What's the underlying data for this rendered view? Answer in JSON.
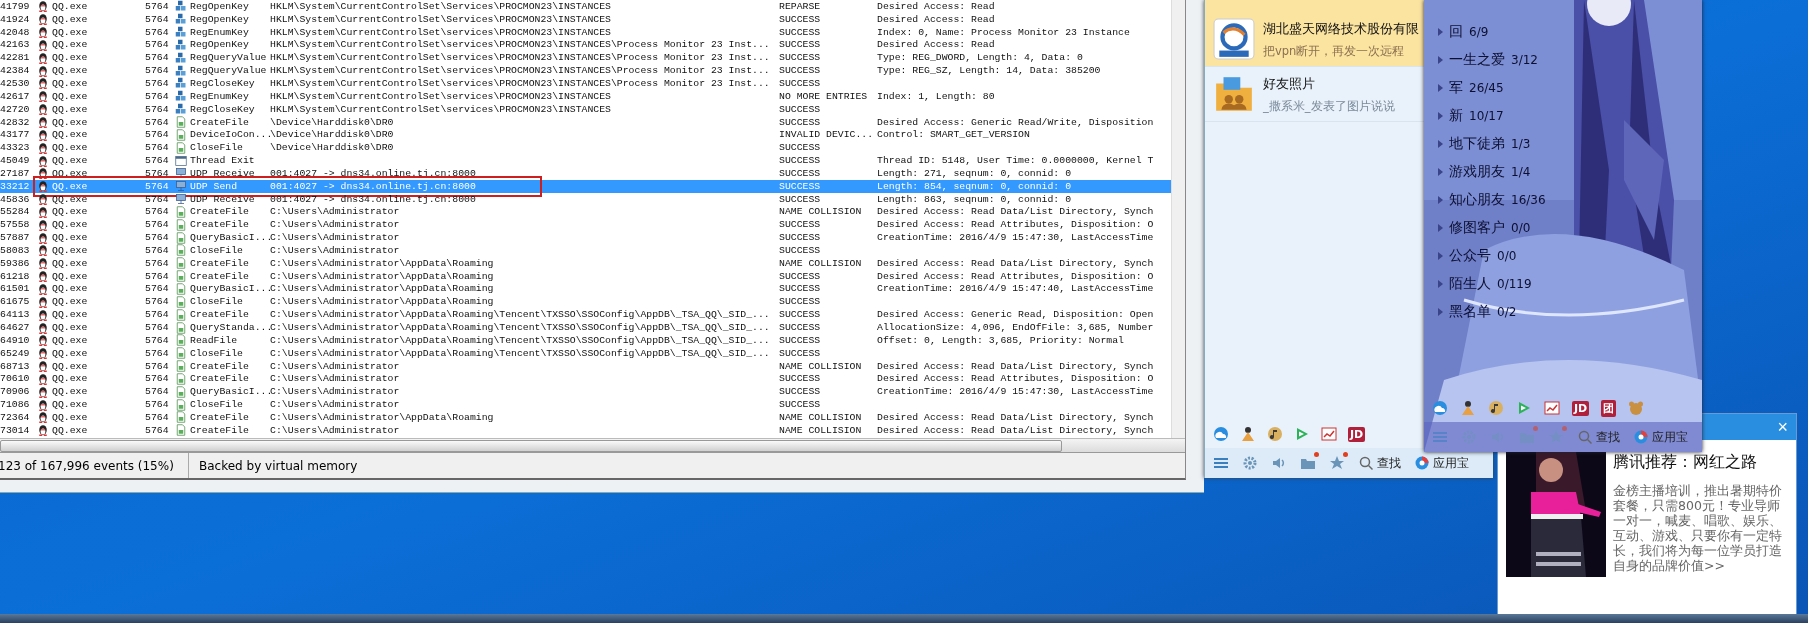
{
  "procmon": {
    "rows": [
      {
        "id": "41799",
        "process": "QQ.exe",
        "pid": "5764",
        "kind": "registry",
        "operation": "RegOpenKey",
        "path": "HKLM\\System\\CurrentControlSet\\Services\\PROCMON23\\INSTANCES",
        "result": "REPARSE",
        "detail": "Desired Access: Read",
        "selected": false,
        "annotated": false
      },
      {
        "id": "41924",
        "process": "QQ.exe",
        "pid": "5764",
        "kind": "registry",
        "operation": "RegOpenKey",
        "path": "HKLM\\System\\CurrentControlSet\\Services\\PROCMON23\\INSTANCES",
        "result": "SUCCESS",
        "detail": "Desired Access: Read",
        "selected": false,
        "annotated": false
      },
      {
        "id": "42048",
        "process": "QQ.exe",
        "pid": "5764",
        "kind": "registry",
        "operation": "RegEnumKey",
        "path": "HKLM\\System\\CurrentControlSet\\services\\PROCMON23\\INSTANCES",
        "result": "SUCCESS",
        "detail": "Index: 0, Name: Process Monitor 23 Instance",
        "selected": false,
        "annotated": false
      },
      {
        "id": "42163",
        "process": "QQ.exe",
        "pid": "5764",
        "kind": "registry",
        "operation": "RegOpenKey",
        "path": "HKLM\\System\\CurrentControlSet\\services\\PROCMON23\\INSTANCES\\Process Monitor 23 Inst...",
        "result": "SUCCESS",
        "detail": "Desired Access: Read",
        "selected": false,
        "annotated": false
      },
      {
        "id": "42281",
        "process": "QQ.exe",
        "pid": "5764",
        "kind": "registry",
        "operation": "RegQueryValue",
        "path": "HKLM\\System\\CurrentControlSet\\services\\PROCMON23\\INSTANCES\\Process Monitor 23 Inst...",
        "result": "SUCCESS",
        "detail": "Type: REG_DWORD, Length: 4, Data: 0",
        "selected": false,
        "annotated": false
      },
      {
        "id": "42384",
        "process": "QQ.exe",
        "pid": "5764",
        "kind": "registry",
        "operation": "RegQueryValue",
        "path": "HKLM\\System\\CurrentControlSet\\services\\PROCMON23\\INSTANCES\\Process Monitor 23 Inst...",
        "result": "SUCCESS",
        "detail": "Type: REG_SZ, Length: 14, Data: 385200",
        "selected": false,
        "annotated": false
      },
      {
        "id": "42530",
        "process": "QQ.exe",
        "pid": "5764",
        "kind": "registry",
        "operation": "RegCloseKey",
        "path": "HKLM\\System\\CurrentControlSet\\services\\PROCMON23\\INSTANCES\\Process Monitor 23 Inst...",
        "result": "SUCCESS",
        "detail": "",
        "selected": false,
        "annotated": false
      },
      {
        "id": "42617",
        "process": "QQ.exe",
        "pid": "5764",
        "kind": "registry",
        "operation": "RegEnumKey",
        "path": "HKLM\\System\\CurrentControlSet\\services\\PROCMON23\\INSTANCES",
        "result": "NO MORE ENTRIES",
        "detail": "Index: 1, Length: 80",
        "selected": false,
        "annotated": false
      },
      {
        "id": "42720",
        "process": "QQ.exe",
        "pid": "5764",
        "kind": "registry",
        "operation": "RegCloseKey",
        "path": "HKLM\\System\\CurrentControlSet\\services\\PROCMON23\\INSTANCES",
        "result": "SUCCESS",
        "detail": "",
        "selected": false,
        "annotated": false
      },
      {
        "id": "42832",
        "process": "QQ.exe",
        "pid": "5764",
        "kind": "file",
        "operation": "CreateFile",
        "path": "\\Device\\Harddisk0\\DR0",
        "result": "SUCCESS",
        "detail": "Desired Access: Generic Read/Write, Disposition",
        "selected": false,
        "annotated": false
      },
      {
        "id": "43177",
        "process": "QQ.exe",
        "pid": "5764",
        "kind": "file",
        "operation": "DeviceIoCon...",
        "path": "\\Device\\Harddisk0\\DR0",
        "result": "INVALID DEVIC...",
        "detail": "Control: SMART_GET_VERSION",
        "selected": false,
        "annotated": false
      },
      {
        "id": "43323",
        "process": "QQ.exe",
        "pid": "5764",
        "kind": "file",
        "operation": "CloseFile",
        "path": "\\Device\\Harddisk0\\DR0",
        "result": "SUCCESS",
        "detail": "",
        "selected": false,
        "annotated": false
      },
      {
        "id": "45049",
        "process": "QQ.exe",
        "pid": "5764",
        "kind": "thread",
        "operation": "Thread Exit",
        "path": "",
        "result": "SUCCESS",
        "detail": "Thread ID: 5148, User Time: 0.0000000, Kernel T",
        "selected": false,
        "annotated": false
      },
      {
        "id": "27187",
        "process": "QQ.exe",
        "pid": "5764",
        "kind": "network",
        "operation": "UDP Receive",
        "path": "001:4027 -> dns34.online.tj.cn:8000",
        "result": "SUCCESS",
        "detail": "Length: 271, seqnum: 0, connid: 0",
        "selected": false,
        "annotated": false
      },
      {
        "id": "33212",
        "process": "QQ.exe",
        "pid": "5764",
        "kind": "network",
        "operation": "UDP Send",
        "path": "001:4027 -> dns34.online.tj.cn:8000",
        "result": "SUCCESS",
        "detail": "Length: 854, seqnum: 0, connid: 0",
        "selected": true,
        "annotated": true
      },
      {
        "id": "45836",
        "process": "QQ.exe",
        "pid": "5764",
        "kind": "network",
        "operation": "UDP Receive",
        "path": "001:4027 -> dns34.online.tj.cn:8000",
        "result": "SUCCESS",
        "detail": "Length: 863, seqnum: 0, connid: 0",
        "selected": false,
        "annotated": false
      },
      {
        "id": "55284",
        "process": "QQ.exe",
        "pid": "5764",
        "kind": "file",
        "operation": "CreateFile",
        "path": "C:\\Users\\Administrator",
        "result": "NAME COLLISION",
        "detail": "Desired Access: Read Data/List Directory, Synch",
        "selected": false,
        "annotated": false
      },
      {
        "id": "57558",
        "process": "QQ.exe",
        "pid": "5764",
        "kind": "file",
        "operation": "CreateFile",
        "path": "C:\\Users\\Administrator",
        "result": "SUCCESS",
        "detail": "Desired Access: Read Attributes, Disposition: O",
        "selected": false,
        "annotated": false
      },
      {
        "id": "57887",
        "process": "QQ.exe",
        "pid": "5764",
        "kind": "file",
        "operation": "QueryBasicI...",
        "path": "C:\\Users\\Administrator",
        "result": "SUCCESS",
        "detail": "CreationTime: 2016/4/9 15:47:30, LastAccessTime",
        "selected": false,
        "annotated": false
      },
      {
        "id": "58083",
        "process": "QQ.exe",
        "pid": "5764",
        "kind": "file",
        "operation": "CloseFile",
        "path": "C:\\Users\\Administrator",
        "result": "SUCCESS",
        "detail": "",
        "selected": false,
        "annotated": false
      },
      {
        "id": "59386",
        "process": "QQ.exe",
        "pid": "5764",
        "kind": "file",
        "operation": "CreateFile",
        "path": "C:\\Users\\Administrator\\AppData\\Roaming",
        "result": "NAME COLLISION",
        "detail": "Desired Access: Read Data/List Directory, Synch",
        "selected": false,
        "annotated": false
      },
      {
        "id": "61218",
        "process": "QQ.exe",
        "pid": "5764",
        "kind": "file",
        "operation": "CreateFile",
        "path": "C:\\Users\\Administrator\\AppData\\Roaming",
        "result": "SUCCESS",
        "detail": "Desired Access: Read Attributes, Disposition: O",
        "selected": false,
        "annotated": false
      },
      {
        "id": "61501",
        "process": "QQ.exe",
        "pid": "5764",
        "kind": "file",
        "operation": "QueryBasicI...",
        "path": "C:\\Users\\Administrator\\AppData\\Roaming",
        "result": "SUCCESS",
        "detail": "CreationTime: 2016/4/9 15:47:40, LastAccessTime",
        "selected": false,
        "annotated": false
      },
      {
        "id": "61675",
        "process": "QQ.exe",
        "pid": "5764",
        "kind": "file",
        "operation": "CloseFile",
        "path": "C:\\Users\\Administrator\\AppData\\Roaming",
        "result": "SUCCESS",
        "detail": "",
        "selected": false,
        "annotated": false
      },
      {
        "id": "64113",
        "process": "QQ.exe",
        "pid": "5764",
        "kind": "file",
        "operation": "CreateFile",
        "path": "C:\\Users\\Administrator\\AppData\\Roaming\\Tencent\\TXSSO\\SSOConfig\\AppDB\\_TSA_QQ\\_SID_...",
        "result": "SUCCESS",
        "detail": "Desired Access: Generic Read, Disposition: Open",
        "selected": false,
        "annotated": false
      },
      {
        "id": "64627",
        "process": "QQ.exe",
        "pid": "5764",
        "kind": "file",
        "operation": "QueryStanda...",
        "path": "C:\\Users\\Administrator\\AppData\\Roaming\\Tencent\\TXSSO\\SSOConfig\\AppDB\\_TSA_QQ\\_SID_...",
        "result": "SUCCESS",
        "detail": "AllocationSize: 4,096, EndOfFile: 3,685, Number",
        "selected": false,
        "annotated": false
      },
      {
        "id": "64910",
        "process": "QQ.exe",
        "pid": "5764",
        "kind": "file",
        "operation": "ReadFile",
        "path": "C:\\Users\\Administrator\\AppData\\Roaming\\Tencent\\TXSSO\\SSOConfig\\AppDB\\_TSA_QQ\\_SID_...",
        "result": "SUCCESS",
        "detail": "Offset: 0, Length: 3,685, Priority: Normal",
        "selected": false,
        "annotated": false
      },
      {
        "id": "65249",
        "process": "QQ.exe",
        "pid": "5764",
        "kind": "file",
        "operation": "CloseFile",
        "path": "C:\\Users\\Administrator\\AppData\\Roaming\\Tencent\\TXSSO\\SSOConfig\\AppDB\\_TSA_QQ\\_SID_...",
        "result": "SUCCESS",
        "detail": "",
        "selected": false,
        "annotated": false
      },
      {
        "id": "68713",
        "process": "QQ.exe",
        "pid": "5764",
        "kind": "file",
        "operation": "CreateFile",
        "path": "C:\\Users\\Administrator",
        "result": "NAME COLLISION",
        "detail": "Desired Access: Read Data/List Directory, Synch",
        "selected": false,
        "annotated": false
      },
      {
        "id": "70610",
        "process": "QQ.exe",
        "pid": "5764",
        "kind": "file",
        "operation": "CreateFile",
        "path": "C:\\Users\\Administrator",
        "result": "SUCCESS",
        "detail": "Desired Access: Read Attributes, Disposition: O",
        "selected": false,
        "annotated": false
      },
      {
        "id": "70906",
        "process": "QQ.exe",
        "pid": "5764",
        "kind": "file",
        "operation": "QueryBasicI...",
        "path": "C:\\Users\\Administrator",
        "result": "SUCCESS",
        "detail": "CreationTime: 2016/4/9 15:47:30, LastAccessTime",
        "selected": false,
        "annotated": false
      },
      {
        "id": "71086",
        "process": "QQ.exe",
        "pid": "5764",
        "kind": "file",
        "operation": "CloseFile",
        "path": "C:\\Users\\Administrator",
        "result": "SUCCESS",
        "detail": "",
        "selected": false,
        "annotated": false
      },
      {
        "id": "72364",
        "process": "QQ.exe",
        "pid": "5764",
        "kind": "file",
        "operation": "CreateFile",
        "path": "C:\\Users\\Administrator\\AppData\\Roaming",
        "result": "NAME COLLISION",
        "detail": "Desired Access: Read Data/List Directory, Synch",
        "selected": false,
        "annotated": false
      },
      {
        "id": "73014",
        "process": "QQ.exe",
        "pid": "5764",
        "kind": "file",
        "operation": "CreateFile",
        "path": "C:\\Users\\Administrator",
        "result": "NAME COLLISION",
        "detail": "Desired Access: Read Data/List Directory, Synch",
        "selected": false,
        "annotated": false
      }
    ],
    "status_bar": [
      "123 of 167,996 events (15%)",
      "Backed by virtual memory"
    ]
  },
  "qq": {
    "contacts": [
      {
        "name": "湖北盛天网络技术股份有限",
        "message": "把vpn断开，再发一次远程",
        "kind": "logo",
        "highlighted": true
      },
      {
        "name": "好友照片",
        "message": "_撒系米_发表了图片说说",
        "kind": "folder",
        "highlighted": false
      }
    ],
    "apps": [
      {
        "kind": "cloud"
      },
      {
        "kind": "figure"
      },
      {
        "kind": "music"
      },
      {
        "kind": "play"
      },
      {
        "kind": "chart"
      },
      {
        "kind": "badge",
        "label": "JD"
      }
    ],
    "toolbar": [
      {
        "kind": "menu",
        "notify": false
      },
      {
        "kind": "settings",
        "notify": false
      },
      {
        "kind": "speaker",
        "notify": false
      },
      {
        "kind": "folder",
        "notify": true
      },
      {
        "kind": "star",
        "notify": true
      },
      {
        "kind": "search",
        "label": "查找"
      },
      {
        "kind": "appstore",
        "label": "应用宝"
      }
    ]
  },
  "skin_panel": {
    "groups": [
      {
        "name": "回",
        "count": "6/9",
        "expanded": false
      },
      {
        "name": "一生之爱",
        "count": "3/12",
        "expanded": false
      },
      {
        "name": "军",
        "count": "26/45",
        "expanded": false
      },
      {
        "name": "新",
        "count": "10/17",
        "expanded": false
      },
      {
        "name": "地下徒弟",
        "count": "1/3",
        "expanded": false
      },
      {
        "name": "游戏朋友",
        "count": "1/4",
        "expanded": false
      },
      {
        "name": "知心朋友",
        "count": "16/36",
        "expanded": false
      },
      {
        "name": "修图客户",
        "count": "0/0",
        "expanded": false
      },
      {
        "name": "公众号",
        "count": "0/0",
        "expanded": false
      },
      {
        "name": "陌生人",
        "count": "0/119",
        "expanded": false
      },
      {
        "name": "黑名单",
        "count": "0/2",
        "expanded": false
      }
    ],
    "apps": [
      {
        "kind": "cloud"
      },
      {
        "kind": "figure"
      },
      {
        "kind": "music"
      },
      {
        "kind": "play"
      },
      {
        "kind": "chart"
      },
      {
        "kind": "badge",
        "label": "JD"
      },
      {
        "kind": "badge",
        "label": "团"
      },
      {
        "kind": "pet"
      }
    ],
    "toolbar": [
      {
        "kind": "menu",
        "notify": false
      },
      {
        "kind": "settings",
        "notify": false
      },
      {
        "kind": "speaker",
        "notify": false
      },
      {
        "kind": "folder",
        "notify": true
      },
      {
        "kind": "star",
        "notify": true
      },
      {
        "kind": "search",
        "label": "查找"
      },
      {
        "kind": "appstore",
        "label": "应用宝"
      }
    ]
  },
  "popup": {
    "close": "×",
    "title": "腾讯推荐：网红之路",
    "body": "金榜主播培训，推出暑期特价套餐，只需800元！专业导师一对一，喊麦、唱歌、娱乐、互动、游戏、只要你有一定特长，我们将为每一位学员打造自身的品牌价值>>"
  }
}
